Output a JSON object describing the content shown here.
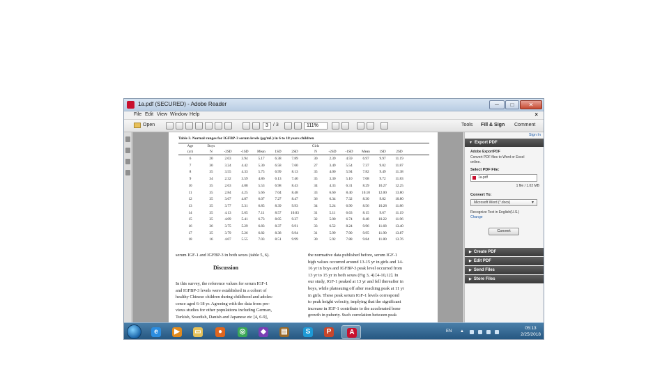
{
  "window": {
    "title": "1a.pdf (SECURED) - Adobe Reader",
    "controls": [
      "─",
      "□",
      "✕"
    ]
  },
  "menu": [
    "File",
    "Edit",
    "View",
    "Window",
    "Help"
  ],
  "menu_close": "×",
  "toolbar": {
    "open_label": "Open",
    "page_current": "3",
    "page_total": "/ 3",
    "zoom": "111%",
    "tabs": [
      "Tools",
      "Fill & Sign",
      "Comment"
    ]
  },
  "document": {
    "table_caption": "Table 3. Normal ranges for IGFBP-3 serum levels (μg/mL) in 6 to 18 years children",
    "table_header1": [
      "Age",
      "Boys",
      "",
      "",
      "",
      "",
      "",
      "Girls",
      "",
      "",
      "",
      "",
      ""
    ],
    "table_header2": [
      "(yr)",
      "N",
      "-2SD",
      "-1SD",
      "Mean",
      "1SD",
      "2SD",
      "N",
      "-2SD",
      "-1SD",
      "Mean",
      "1SD",
      "2SD"
    ],
    "table_rows": [
      [
        "6",
        "20",
        "2.03",
        "3.94",
        "5.17",
        "6.38",
        "7.89",
        "30",
        "2.39",
        "4.59",
        "6.97",
        "9.97",
        "11.19"
      ],
      [
        "7",
        "30",
        "3.24",
        "4.42",
        "5.30",
        "6.58",
        "7.60",
        "27",
        "3.49",
        "5.54",
        "7.37",
        "9.02",
        "11.87"
      ],
      [
        "8",
        "35",
        "3.55",
        "4.33",
        "5.75",
        "6.99",
        "8.13",
        "35",
        "4.00",
        "5.94",
        "7.82",
        "9.49",
        "11.38"
      ],
      [
        "9",
        "34",
        "2.32",
        "3.59",
        "4.86",
        "6.13",
        "7.40",
        "35",
        "3.30",
        "5.10",
        "7.08",
        "9.72",
        "11.83"
      ],
      [
        "10",
        "35",
        "2.63",
        "4.08",
        "5.53",
        "6.98",
        "8.43",
        "34",
        "4.33",
        "6.31",
        "8.29",
        "10.27",
        "12.25"
      ],
      [
        "11",
        "35",
        "2.84",
        "4.25",
        "5.66",
        "7.04",
        "8.48",
        "33",
        "6.60",
        "8.40",
        "10.10",
        "12.00",
        "13.80"
      ],
      [
        "12",
        "35",
        "3.67",
        "4.87",
        "6.07",
        "7.27",
        "8.47",
        "36",
        "6.34",
        "7.32",
        "8.30",
        "9.82",
        "10.80"
      ],
      [
        "13",
        "35",
        "3.77",
        "5.31",
        "6.85",
        "8.39",
        "9.93",
        "34",
        "5.24",
        "6.90",
        "8.56",
        "10.28",
        "11.86"
      ],
      [
        "14",
        "35",
        "4.13",
        "5.65",
        "7.11",
        "8.57",
        "10.03",
        "31",
        "5.11",
        "6.63",
        "8.15",
        "9.67",
        "11.19"
      ],
      [
        "15",
        "35",
        "4.09",
        "5.41",
        "6.73",
        "8.05",
        "9.37",
        "32",
        "5.00",
        "6.74",
        "8.48",
        "10.22",
        "11.96"
      ],
      [
        "16",
        "36",
        "3.75",
        "5.29",
        "6.83",
        "8.37",
        "9.91",
        "33",
        "6.52",
        "8.24",
        "9.96",
        "11.68",
        "13.40"
      ],
      [
        "17",
        "35",
        "3.79",
        "5.26",
        "6.82",
        "8.38",
        "9.94",
        "31",
        "5.99",
        "7.90",
        "9.95",
        "11.90",
        "13.87"
      ],
      [
        "18",
        "16",
        "4.07",
        "5.55",
        "7.03",
        "8.51",
        "9.99",
        "30",
        "5.92",
        "7.88",
        "9.84",
        "11.80",
        "13.76"
      ]
    ],
    "left_top_line": "serum IGF-1 and IGFBP-3 in both sexes (table 5, 6).",
    "heading": "Discussion",
    "left_para": [
      "In this survey, the reference values for serum IGF-1",
      "and IGFBP-3 levels were established in a cohort of",
      "healthy Chinese children during childhood and adoles-",
      "cence aged 6-18 yr. Agreeing with the data from pre-",
      "vious studies for other populations including German,",
      "Turkish, Swedish, Danish and Japanese etc [4, 6-9],"
    ],
    "right_para": [
      "the normative data published before, serum IGF-1",
      "high values occurred around 13-15 yr in girls and 14-",
      "16 yr in boys and IGFBP-3 peak level occurred from",
      "13 yr to 15 yr in both sexes (Fig 3, 4) [4-10,12]. In",
      "our study, IGF-1 peaked at 13 yr and fell thereafter in",
      "boys, while plateauing off after reaching peak at 11 yr",
      "in girls. These peak serum IGF-1 levels correspond",
      "to peak height velocity, implying that the significant",
      "increase in IGF-1 contribute to the accelerated bone",
      "growth in puberty. Such correlation between peak"
    ]
  },
  "right_panel": {
    "sign_in": "Sign In",
    "export_header": "Export PDF",
    "adobe_exportpdf": "Adobe ExportPDF",
    "convert_desc": [
      "Convert PDF files to Word or Excel",
      "online."
    ],
    "select_file_label": "Select PDF File:",
    "selected_file": "1a.pdf",
    "file_info": "1 file / 1.02 MB",
    "convert_to_label": "Convert To:",
    "convert_to_value": "Microsoft Word (*.docx)",
    "recognize_text": "Recognize Text in English(U.S.)",
    "change_link": "Change",
    "convert_button": "Convert",
    "sections": [
      "Create PDF",
      "Edit PDF",
      "Send Files",
      "Store Files"
    ]
  },
  "taskbar": {
    "tray": [
      "EN",
      "▲"
    ],
    "time": "05:13",
    "date": "2/25/2018",
    "apps": [
      {
        "icon": "internet-explorer-icon",
        "glyph": "e",
        "color": "#2b8de0",
        "active": false
      },
      {
        "icon": "media-player-icon",
        "glyph": "▶",
        "color": "#e08a1e",
        "active": false
      },
      {
        "icon": "file-explorer-icon",
        "glyph": "▭",
        "color": "#e5c15a",
        "active": false
      },
      {
        "icon": "firefox-icon",
        "glyph": "●",
        "color": "#e0661e",
        "active": false
      },
      {
        "icon": "chrome-icon",
        "glyph": "◎",
        "color": "#3aa757",
        "active": false
      },
      {
        "icon": "visual-studio-icon",
        "glyph": "◆",
        "color": "#7a3fb5",
        "active": false
      },
      {
        "icon": "winrar-icon",
        "glyph": "▤",
        "color": "#9a6a2a",
        "active": false
      },
      {
        "icon": "skype-icon",
        "glyph": "S",
        "color": "#1d9ad6",
        "active": false
      },
      {
        "icon": "powerpoint-icon",
        "glyph": "P",
        "color": "#c8462b",
        "active": false
      },
      {
        "icon": "adobe-reader-icon",
        "glyph": "A",
        "color": "#c8102e",
        "active": true
      }
    ]
  }
}
